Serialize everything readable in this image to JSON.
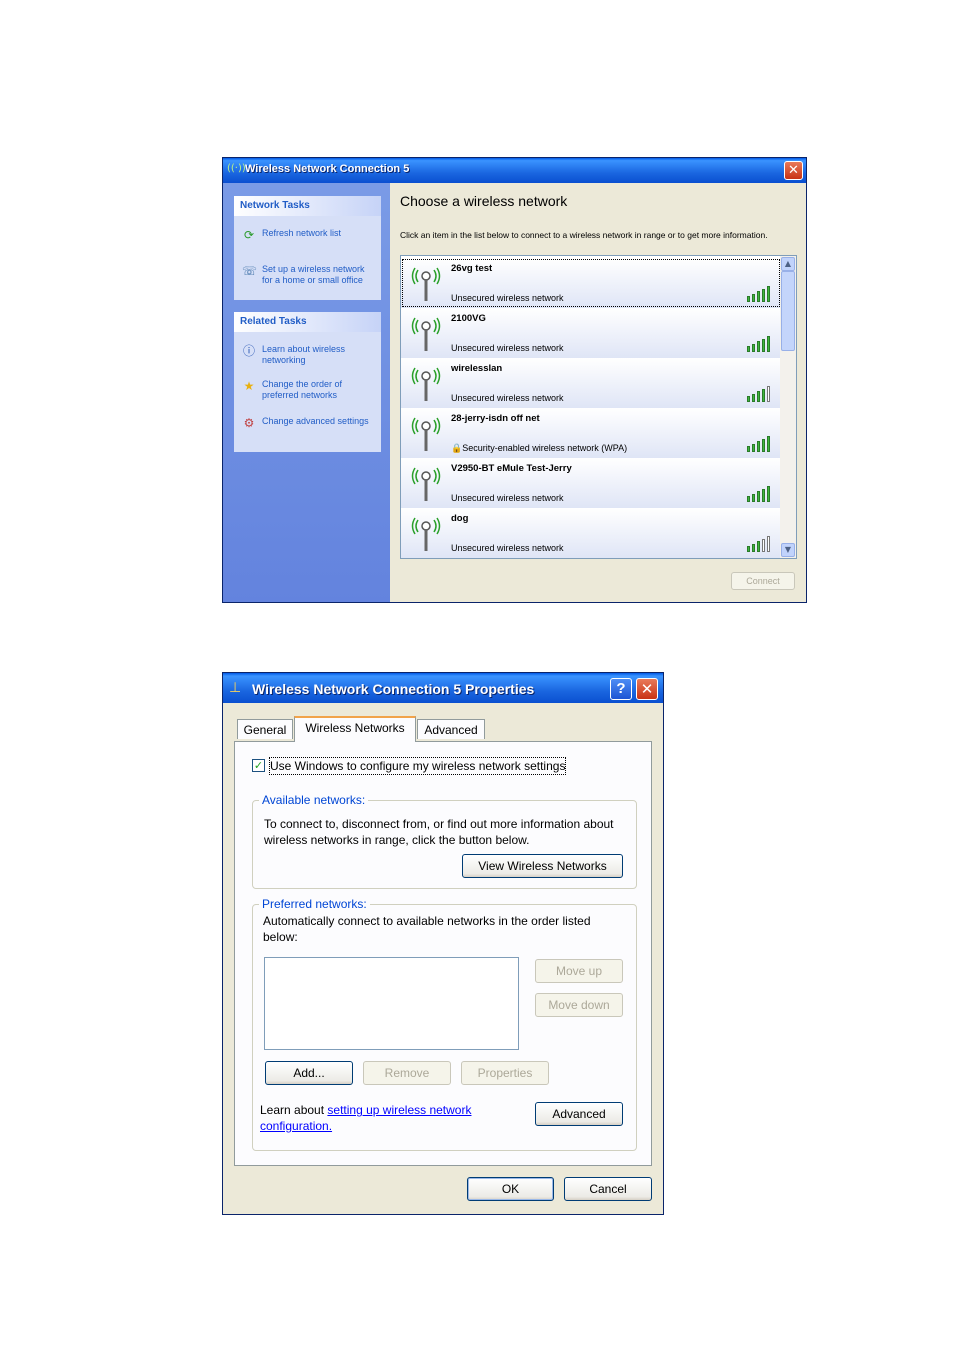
{
  "window1": {
    "title": "Wireless Network Connection 5",
    "title_icon": "wireless-signal-icon",
    "sidebar": {
      "network_tasks": {
        "header": "Network Tasks",
        "items": [
          {
            "icon": "refresh-icon",
            "label": "Refresh network list"
          },
          {
            "icon": "wireless-setup-icon",
            "label": "Set up a wireless network for a home or small office"
          }
        ]
      },
      "related_tasks": {
        "header": "Related Tasks",
        "items": [
          {
            "icon": "info-icon",
            "label": "Learn about wireless networking"
          },
          {
            "icon": "star-icon",
            "label": "Change the order of preferred networks"
          },
          {
            "icon": "settings-icon",
            "label": "Change advanced settings"
          }
        ]
      }
    },
    "main": {
      "heading": "Choose a wireless network",
      "description": "Click an item in the list below to connect to a wireless network in range or to get more information.",
      "networks": [
        {
          "name": "26vg test",
          "status": "Unsecured wireless network",
          "signal": 5,
          "selected": true
        },
        {
          "name": "2100VG",
          "status": "Unsecured wireless network",
          "signal": 5
        },
        {
          "name": "wirelesslan",
          "status": "Unsecured wireless network",
          "signal": 4
        },
        {
          "name": "28-jerry-isdn off net",
          "status": "Security-enabled wireless network (WPA)",
          "signal": 5,
          "secured": true
        },
        {
          "name": "V2950-BT eMule Test-Jerry",
          "status": "Unsecured wireless network",
          "signal": 5
        },
        {
          "name": "dog",
          "status": "Unsecured wireless network",
          "signal": 3
        }
      ],
      "connect_label": "Connect"
    }
  },
  "window2": {
    "title": "Wireless Network Connection 5 Properties",
    "tabs": [
      "General",
      "Wireless Networks",
      "Advanced"
    ],
    "active_tab": "Wireless Networks",
    "use_windows_label": "Use Windows to configure my wireless network settings",
    "use_windows_checked": true,
    "available": {
      "title": "Available networks:",
      "text": "To connect to, disconnect from, or find out more information about wireless networks in range, click the button below.",
      "view_button": "View Wireless Networks"
    },
    "preferred": {
      "title": "Preferred networks:",
      "text": "Automatically connect to available networks in the order listed below:",
      "move_up": "Move up",
      "move_down": "Move down",
      "add": "Add...",
      "remove": "Remove",
      "properties": "Properties"
    },
    "learn_prefix": "Learn about",
    "learn_link": "setting up wireless network configuration.",
    "advanced_button": "Advanced",
    "ok": "OK",
    "cancel": "Cancel"
  },
  "colors": {
    "title_bar": "#0058e6",
    "sidebar": "#6f8fe2",
    "link": "#215dc6",
    "signal_on": "#3db83d"
  }
}
